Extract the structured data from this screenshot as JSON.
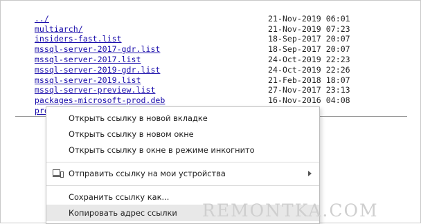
{
  "listing": [
    {
      "name": "../",
      "date": ""
    },
    {
      "name": "multiarch/",
      "date": "21-Nov-2019 06:01"
    },
    {
      "name": "insiders-fast.list",
      "date": "21-Nov-2019 07:23"
    },
    {
      "name": "mssql-server-2017-gdr.list",
      "date": "18-Sep-2017 20:07"
    },
    {
      "name": "mssql-server-2017.list",
      "date": "18-Sep-2017 20:07"
    },
    {
      "name": "mssql-server-2019-gdr.list",
      "date": "24-Oct-2019 22:23"
    },
    {
      "name": "mssql-server-2019.list",
      "date": "24-Oct-2019 22:26"
    },
    {
      "name": "mssql-server-preview.list",
      "date": "21-Feb-2018 18:07"
    },
    {
      "name": "packages-microsoft-prod.deb",
      "date": "27-Nov-2017 23:13"
    },
    {
      "name": "prod.list",
      "date": "16-Nov-2016 04:08"
    }
  ],
  "context_menu": {
    "open_new_tab": "Открыть ссылку в новой вкладке",
    "open_new_window": "Открыть ссылку в новом окне",
    "open_incognito": "Открыть ссылку в окне в режиме инкогнито",
    "send_to_devices": "Отправить ссылку на мои устройства",
    "save_link_as": "Сохранить ссылку как...",
    "copy_link_address": "Копировать адрес ссылки",
    "highlighted_item": "copy_link_address"
  },
  "watermark": "REMONTKA.COM",
  "colors": {
    "link": "#1a0dab",
    "menu_highlight": "#e8e8e8"
  }
}
